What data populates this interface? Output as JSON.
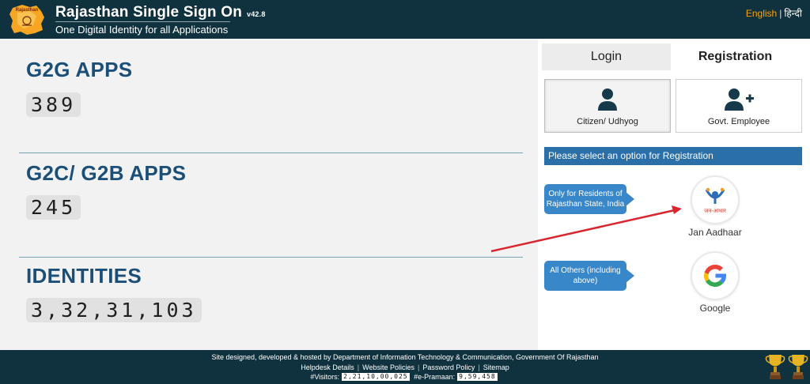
{
  "header": {
    "title": "Rajasthan Single Sign On",
    "version": "v42.8",
    "subtitle": "One Digital Identity for all Applications",
    "logo_text": "Rajasthan",
    "lang_english": "English",
    "lang_hindi": "हिन्दी",
    "bg_color": "#10323f",
    "accent_color": "#f3a21a"
  },
  "stats": [
    {
      "title": "G2G APPS",
      "value": "389"
    },
    {
      "title": "G2C/ G2B APPS",
      "value": "245"
    },
    {
      "title": "IDENTITIES",
      "value": "3,32,31,103"
    }
  ],
  "tabs": {
    "login": "Login",
    "registration": "Registration",
    "active": "registration"
  },
  "registration": {
    "citizen_label": "Citizen/ Udhyog",
    "citizen_icon": "user-icon",
    "employee_label": "Govt. Employee",
    "employee_icon": "user-plus-icon",
    "banner": "Please select an option for Registration",
    "callout_residents": "Only for Residents of Rajasthan State, India",
    "callout_others": "All Others (including above)",
    "jan_aadhaar_label": "Jan Aadhaar",
    "jan_aadhaar_logo_text": "जन-आधार",
    "google_label": "Google"
  },
  "footer": {
    "line1": "Site designed, developed & hosted by Department of Information Technology & Communication, Government Of Rajasthan",
    "links": [
      "Helpdesk Details",
      "Website Policies",
      "Password Policy",
      "Sitemap"
    ],
    "visitors_label": "#Visitors:",
    "visitors_value": "2,21,10,00,025",
    "epramaan_label": "#e-Pramaan:",
    "epramaan_value": "9,59,458"
  }
}
